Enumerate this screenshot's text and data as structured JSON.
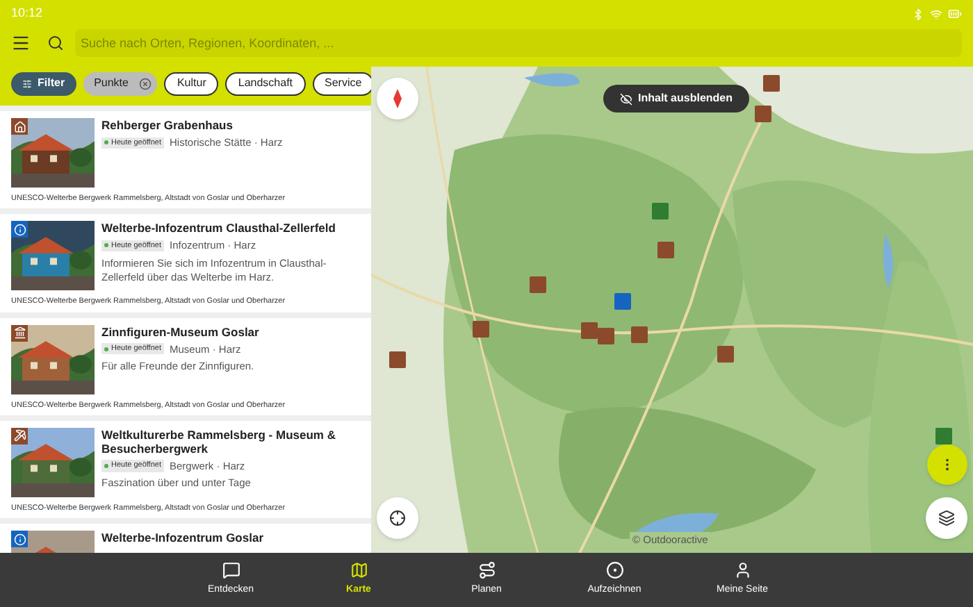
{
  "status_bar": {
    "time": "10:12"
  },
  "search": {
    "placeholder": "Suche nach Orten, Regionen, Koordinaten, ..."
  },
  "filter_chips": [
    {
      "label": "Filter",
      "kind": "filter"
    },
    {
      "label": "Punkte",
      "kind": "removable"
    },
    {
      "label": "Kultur",
      "kind": "plain"
    },
    {
      "label": "Landschaft",
      "kind": "plain"
    },
    {
      "label": "Service",
      "kind": "plain"
    }
  ],
  "results": [
    {
      "title": "Rehberger Grabenhaus",
      "status": "Heute geöffnet",
      "category": "Historische Stätte · Harz",
      "region": "UNESCO-Welterbe Bergwerk Rammelsberg, Altstadt von Goslar und Oberharzer",
      "kind": "house"
    },
    {
      "title": "Welterbe-Infozentrum Clausthal-Zellerfeld",
      "status": "Heute geöffnet",
      "category": "Infozentrum · Harz",
      "description": "Informieren Sie sich im Infozentrum in Clausthal-Zellerfeld über das Welterbe im Harz.",
      "region": "UNESCO-Welterbe Bergwerk Rammelsberg, Altstadt von Goslar und Oberharzer",
      "kind": "info"
    },
    {
      "title": "Zinnfiguren-Museum Goslar",
      "status": "Heute geöffnet",
      "category": "Museum · Harz",
      "description": "Für alle Freunde der Zinnfiguren.",
      "region": "UNESCO-Welterbe Bergwerk Rammelsberg, Altstadt von Goslar und Oberharzer",
      "kind": "museum"
    },
    {
      "title": "Weltkulturerbe Rammelsberg - Museum & Besucherbergwerk",
      "status": "Heute geöffnet",
      "category": "Bergwerk · Harz",
      "description": "Faszination über und unter Tage",
      "region": "UNESCO-Welterbe Bergwerk Rammelsberg, Altstadt von Goslar und Oberharzer",
      "kind": "mine"
    },
    {
      "title": "Welterbe-Infozentrum Goslar",
      "kind": "info"
    }
  ],
  "map": {
    "toggle_label": "Inhalt ausblenden",
    "attribution": "© Outdooractive"
  },
  "nav": [
    {
      "label": "Entdecken",
      "selected": false,
      "kind": "discover"
    },
    {
      "label": "Karte",
      "selected": true,
      "kind": "map"
    },
    {
      "label": "Planen",
      "selected": false,
      "kind": "plan"
    },
    {
      "label": "Aufzeichnen",
      "selected": false,
      "kind": "record"
    },
    {
      "label": "Meine Seite",
      "selected": false,
      "kind": "profile"
    }
  ]
}
